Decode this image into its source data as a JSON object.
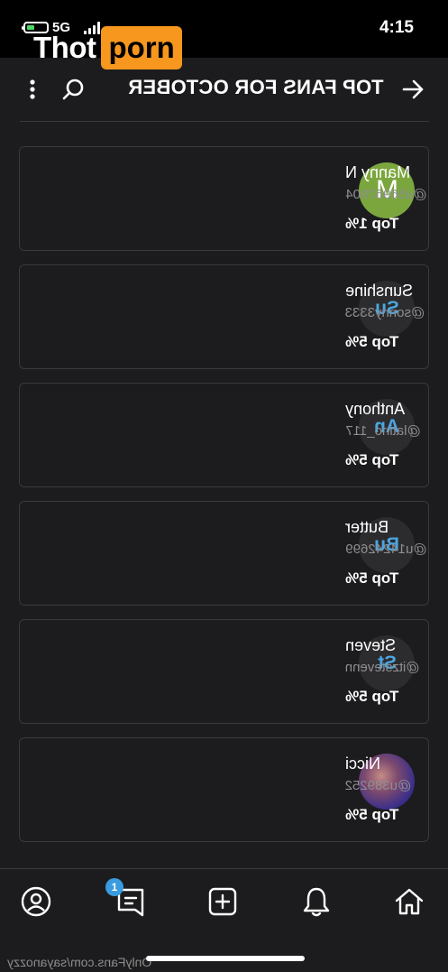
{
  "status_bar": {
    "time": "4:15",
    "network": "5G"
  },
  "watermark": {
    "left_text": "Thot",
    "right_text": "porn"
  },
  "header": {
    "title": "TOP FANS FOR OCTOBER"
  },
  "fans": [
    {
      "initials": "M",
      "name": "Manny N",
      "handle": "@u56967904",
      "rank": "Top 1%"
    },
    {
      "initials": "Su",
      "name": "Sunshine",
      "handle": "@sonny3333",
      "rank": "Top 5%"
    },
    {
      "initials": "An",
      "name": "Anthony",
      "handle": "@latino_117",
      "rank": "Top 5%"
    },
    {
      "initials": "Bu",
      "name": "Butter",
      "handle": "@u14242699",
      "rank": "Top 5%"
    },
    {
      "initials": "St",
      "name": "Steven",
      "handle": "@itzstevenn",
      "rank": "Top 5%"
    },
    {
      "initials": "",
      "name": "Nicci",
      "handle": "@u389252",
      "rank": "Top 5%"
    }
  ],
  "bottom_nav": {
    "messages_badge": "1"
  },
  "footer": {
    "credit": "OnlyFans.com/sayanozzy"
  },
  "colors": {
    "background": "#1c1c1e",
    "accent": "#4ba6e0",
    "watermark_orange": "#f7971e",
    "avatar_green": "#7ba63e"
  }
}
